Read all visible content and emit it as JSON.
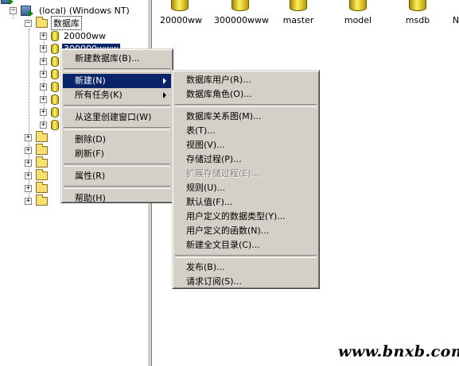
{
  "tree": {
    "server_label": "(local) (Windows NT)",
    "databases_folder": "数据库",
    "db_first": "20000ww",
    "db_second_selected": "300000www"
  },
  "pane": {
    "databases": [
      "20000ww",
      "300000www",
      "master",
      "model",
      "msdb",
      "N"
    ]
  },
  "context_menu": {
    "items": [
      {
        "label": "新建数据库(B)..."
      },
      {
        "label": "新建(N)"
      },
      {
        "label": "所有任务(K)"
      },
      {
        "label": "从这里创建窗口(W)"
      },
      {
        "label": "删除(D)"
      },
      {
        "label": "刷新(F)"
      },
      {
        "label": "属性(R)"
      },
      {
        "label": "帮助(H)"
      }
    ]
  },
  "submenu": {
    "items": [
      {
        "label": "数据库用户(R)..."
      },
      {
        "label": "数据库角色(O)..."
      },
      {
        "label": "数据库关系图(M)..."
      },
      {
        "label": "表(T)..."
      },
      {
        "label": "视图(V)..."
      },
      {
        "label": "存储过程(P)..."
      },
      {
        "label": "扩展存储过程(E)..."
      },
      {
        "label": "规则(U)..."
      },
      {
        "label": "默认值(F)..."
      },
      {
        "label": "用户定义的数据类型(Y)..."
      },
      {
        "label": "用户定义的函数(N)..."
      },
      {
        "label": "新建全文目录(C)..."
      },
      {
        "label": "发布(B)..."
      },
      {
        "label": "请求订阅(S)..."
      }
    ]
  },
  "watermark": "www.bnxb.com"
}
